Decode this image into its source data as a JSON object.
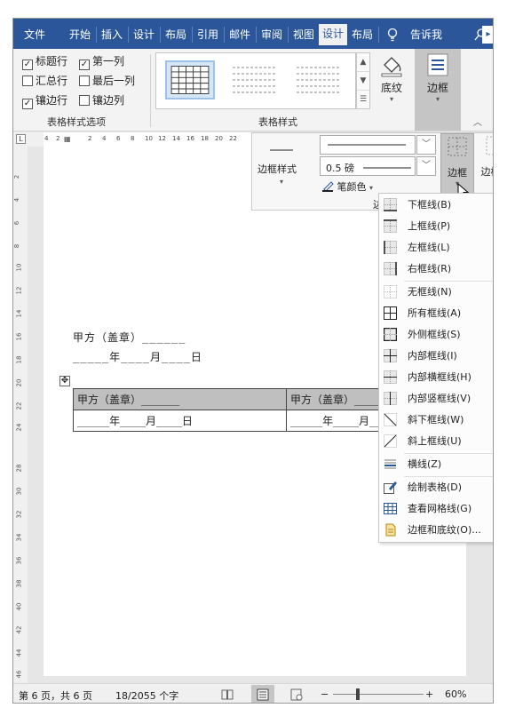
{
  "tabs": [
    "文件",
    "开始",
    "插入",
    "设计",
    "布局",
    "引用",
    "邮件",
    "审阅",
    "视图",
    "设计",
    "布局"
  ],
  "tell_me": "告诉我",
  "options": {
    "items": [
      {
        "label": "标题行",
        "checked": true
      },
      {
        "label": "第一列",
        "checked": true
      },
      {
        "label": "汇总行",
        "checked": false
      },
      {
        "label": "最后一列",
        "checked": false
      },
      {
        "label": "镶边行",
        "checked": true
      },
      {
        "label": "镶边列",
        "checked": false
      }
    ],
    "group_label": "表格样式选项"
  },
  "styles": {
    "group_label": "表格样式",
    "shading_label": "底纹",
    "borders_label": "边框"
  },
  "border_panel": {
    "style_label": "边框样式",
    "weight": "0.5 磅",
    "pen_color_label": "笔颜色",
    "borders_label": "边框",
    "painter_label": "边框刷",
    "group_label": "边框"
  },
  "ruler": {
    "h": [
      "4",
      "2",
      "2",
      "4",
      "6",
      "8",
      "10",
      "12",
      "14",
      "16",
      "18",
      "20",
      "22"
    ],
    "v": [
      "2",
      "4",
      "6",
      "8",
      "10",
      "12",
      "14",
      "16",
      "18",
      "20",
      "22",
      "24",
      "26",
      "28",
      "30",
      "32",
      "34",
      "36",
      "38",
      "40",
      "42",
      "44",
      "46"
    ]
  },
  "document": {
    "line1": "甲方（盖章）______",
    "line2": "_____年____月____日",
    "cell_a1": "甲方（盖章）______",
    "cell_a2": "_____年____月____日",
    "cell_b1": "甲方（盖章）______",
    "cell_b2": "_____年____月____日"
  },
  "menu": {
    "items": [
      {
        "label": "下框线(B)",
        "icon": "bottom-border-icon"
      },
      {
        "label": "上框线(P)",
        "icon": "top-border-icon"
      },
      {
        "label": "左框线(L)",
        "icon": "left-border-icon"
      },
      {
        "label": "右框线(R)",
        "icon": "right-border-icon"
      },
      {
        "label": "无框线(N)",
        "icon": "no-border-icon"
      },
      {
        "label": "所有框线(A)",
        "icon": "all-borders-icon"
      },
      {
        "label": "外侧框线(S)",
        "icon": "outside-borders-icon"
      },
      {
        "label": "内部框线(I)",
        "icon": "inside-borders-icon"
      },
      {
        "label": "内部横框线(H)",
        "icon": "inside-horizontal-border-icon"
      },
      {
        "label": "内部竖框线(V)",
        "icon": "inside-vertical-border-icon"
      },
      {
        "label": "斜下框线(W)",
        "icon": "diagonal-down-border-icon"
      },
      {
        "label": "斜上框线(U)",
        "icon": "diagonal-up-border-icon"
      },
      {
        "label": "横线(Z)",
        "icon": "horizontal-line-icon"
      },
      {
        "label": "绘制表格(D)",
        "icon": "draw-table-icon"
      },
      {
        "label": "查看网格线(G)",
        "icon": "view-gridlines-icon"
      },
      {
        "label": "边框和底纹(O)...",
        "icon": "borders-and-shading-icon"
      }
    ]
  },
  "status": {
    "page": "第 6 页，共 6 页",
    "words": "18/2055 个字",
    "zoom": "60%"
  },
  "colors": {
    "accent": "#2b579a",
    "table_header": "#bfbfbf"
  }
}
